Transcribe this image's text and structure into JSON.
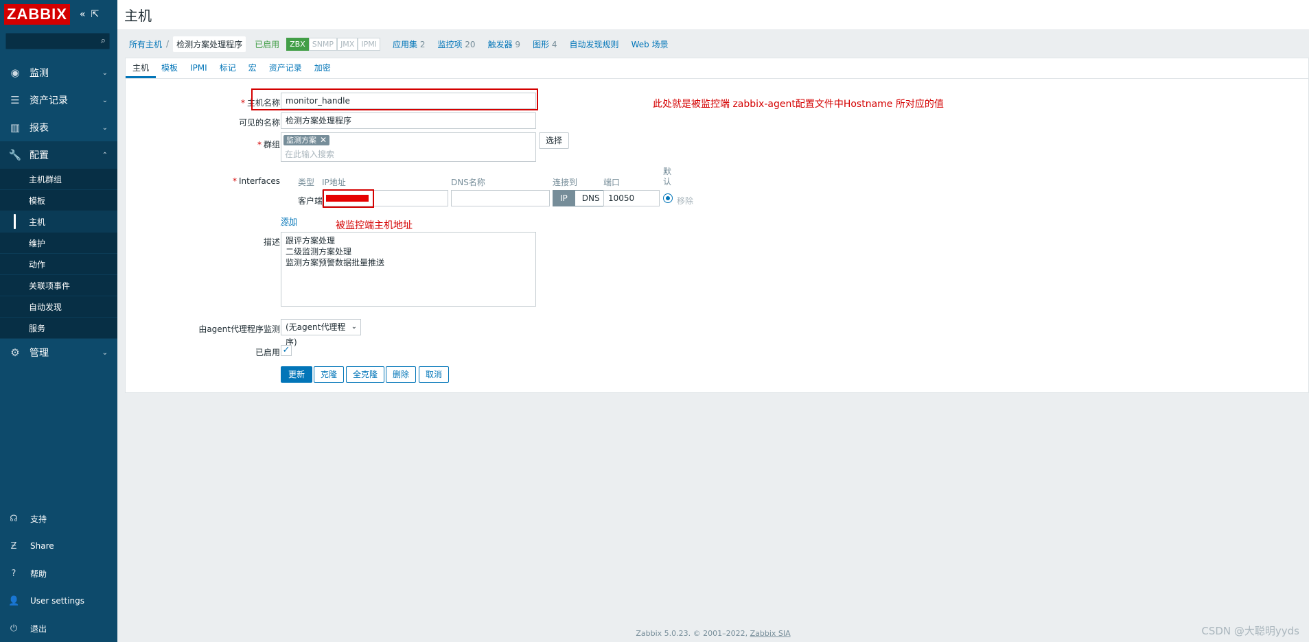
{
  "sidebar": {
    "logo": "ZABBIX",
    "nav": [
      {
        "label": "监测",
        "icon": "eye-icon"
      },
      {
        "label": "资产记录",
        "icon": "list-icon"
      },
      {
        "label": "报表",
        "icon": "bar-chart-icon"
      },
      {
        "label": "配置",
        "icon": "wrench-icon"
      },
      {
        "label": "管理",
        "icon": "gear-icon"
      }
    ],
    "config_items": [
      "主机群组",
      "模板",
      "主机",
      "维护",
      "动作",
      "关联项事件",
      "自动发现",
      "服务"
    ],
    "bottom": [
      {
        "label": "支持",
        "icon": "headset-icon"
      },
      {
        "label": "Share",
        "icon": "share-icon"
      },
      {
        "label": "帮助",
        "icon": "help-icon"
      },
      {
        "label": "User settings",
        "icon": "user-icon"
      },
      {
        "label": "退出",
        "icon": "power-icon"
      }
    ]
  },
  "header": {
    "title": "主机"
  },
  "breadcrumb": {
    "all_hosts": "所有主机",
    "sep": "/",
    "current": "检测方案处理程序",
    "status": "已启用",
    "badges": [
      "ZBX",
      "SNMP",
      "JMX",
      "IPMI"
    ],
    "links": [
      {
        "label": "应用集",
        "count": "2"
      },
      {
        "label": "监控项",
        "count": "20"
      },
      {
        "label": "触发器",
        "count": "9"
      },
      {
        "label": "图形",
        "count": "4"
      },
      {
        "label": "自动发现规则",
        "count": ""
      },
      {
        "label": "Web 场景",
        "count": ""
      }
    ]
  },
  "tabs": [
    "主机",
    "模板",
    "IPMI",
    "标记",
    "宏",
    "资产记录",
    "加密"
  ],
  "form": {
    "hostname_label": "主机名称",
    "hostname_value": "monitor_handle",
    "visible_label": "可见的名称",
    "visible_value": "检测方案处理程序",
    "groups_label": "群组",
    "group_tag": "监测方案",
    "groups_placeholder": "在此输入搜索",
    "select_button": "选择",
    "interfaces_label": "Interfaces",
    "col_type": "类型",
    "col_ip": "IP地址",
    "col_dns": "DNS名称",
    "col_connect": "连接到",
    "col_port": "端口",
    "col_default": "默认",
    "iface_type": "客户端",
    "ip_value": "",
    "dns_value": "",
    "connect_ip": "IP",
    "connect_dns": "DNS",
    "port_value": "10050",
    "remove_link": "移除",
    "add_link": "添加",
    "description_label": "描述",
    "description_value": "跟评方案处理\n二级监测方案处理\n监测方案预警数据批量推送",
    "proxy_label": "由agent代理程序监测",
    "proxy_value": "(无agent代理程序)",
    "enabled_label": "已启用",
    "buttons": {
      "update": "更新",
      "clone": "克隆",
      "full_clone": "全克隆",
      "delete": "删除",
      "cancel": "取消"
    }
  },
  "annotations": {
    "hostname_note": "此处就是被监控端 zabbix-agent配置文件中Hostname 所对应的值",
    "ip_note": "被监控端主机地址"
  },
  "footer": {
    "text": "Zabbix 5.0.23. © 2001–2022, ",
    "link": "Zabbix SIA"
  },
  "watermark": "CSDN @大聪明yyds"
}
